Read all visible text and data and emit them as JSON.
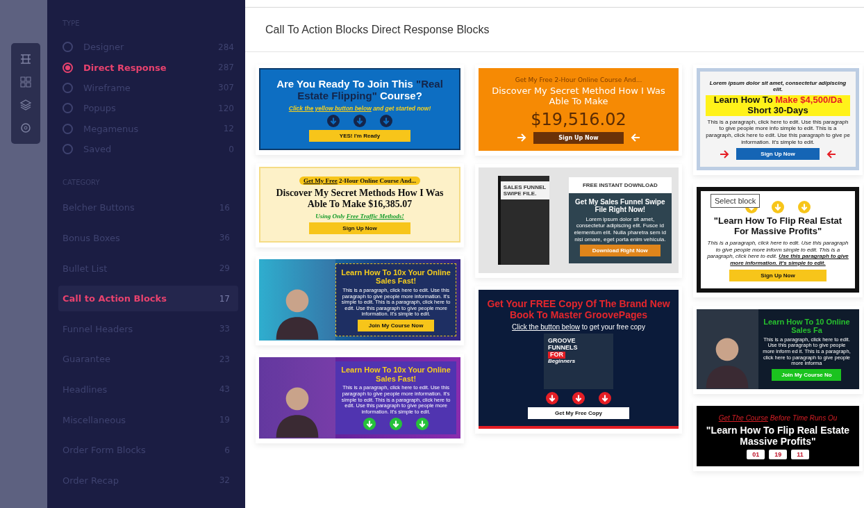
{
  "type_filter": {
    "heading": "TYPE",
    "items": [
      {
        "label": "Designer",
        "count": "284",
        "selected": false
      },
      {
        "label": "Direct Response",
        "count": "287",
        "selected": true
      },
      {
        "label": "Wireframe",
        "count": "307",
        "selected": false
      },
      {
        "label": "Popups",
        "count": "120",
        "selected": false
      },
      {
        "label": "Megamenus",
        "count": "12",
        "selected": false
      },
      {
        "label": "Saved",
        "count": "0",
        "selected": false
      }
    ]
  },
  "category_filter": {
    "heading": "CATEGORY",
    "items": [
      {
        "label": "Belcher Buttons",
        "count": "16",
        "selected": false
      },
      {
        "label": "Bonus Boxes",
        "count": "36",
        "selected": false
      },
      {
        "label": "Bullet List",
        "count": "29",
        "selected": false
      },
      {
        "label": "Call to Action Blocks",
        "count": "17",
        "selected": true
      },
      {
        "label": "Funnel Headers",
        "count": "33",
        "selected": false
      },
      {
        "label": "Guarantee",
        "count": "23",
        "selected": false
      },
      {
        "label": "Headlines",
        "count": "43",
        "selected": false
      },
      {
        "label": "Miscellaneous",
        "count": "19",
        "selected": false
      },
      {
        "label": "Order Form Blocks",
        "count": "6",
        "selected": false
      },
      {
        "label": "Order Recap",
        "count": "32",
        "selected": false
      }
    ]
  },
  "page_title": "Call To Action Blocks Direct Response Blocks",
  "columns": [
    [
      {
        "kind": "blue",
        "parts": [
          {
            "kind": "headline",
            "segments": [
              {
                "text": "Are You Ready To Join This ",
                "accent": false
              },
              {
                "text": "\"Real Estate Flipping\"",
                "accent": true
              },
              {
                "text": " Course?",
                "accent": false
              }
            ]
          },
          {
            "kind": "sub",
            "segments": [
              {
                "text": "Click the yellow button below",
                "accent": true
              },
              {
                "text": " and get started now!",
                "accent": false
              }
            ]
          },
          {
            "kind": "arrows"
          },
          {
            "kind": "button",
            "text": "YES! I'm Ready"
          }
        ]
      },
      {
        "kind": "cream",
        "parts": [
          {
            "kind": "kicker",
            "segments": [
              {
                "text": "Get My Free",
                "accent": true
              },
              {
                "text": " 2-Hour Online Course And...",
                "accent": false
              }
            ]
          },
          {
            "kind": "headline",
            "text": "Discover My Secret Methods How I Was Able To Make $16,385.07"
          },
          {
            "kind": "sub",
            "segments": [
              {
                "text": "Using Only ",
                "accent": false
              },
              {
                "text": "Free Traffic Methods!",
                "accent": true
              }
            ]
          },
          {
            "kind": "button",
            "text": "Sign Up Now"
          }
        ]
      },
      {
        "kind": "teal",
        "parts": [
          {
            "kind": "headline",
            "text": "Learn How To 10x Your Online Sales Fast!"
          },
          {
            "kind": "paragraph",
            "text": "This is a paragraph, click here to edit. Use this paragraph to give people more information. It's simple to edit. This is a paragraph, click here to edit. Use this paragraph to give people more information. It's simple to edit."
          },
          {
            "kind": "button",
            "text": "Join My Course Now"
          }
        ]
      },
      {
        "kind": "purple",
        "parts": [
          {
            "kind": "headline",
            "text": "Learn How To 10x Your Online Sales Fast!"
          },
          {
            "kind": "paragraph",
            "text": "This is a paragraph, click here to edit. Use this paragraph to give people more information. It's simple to edit. This is a paragraph, click here to edit. Use this paragraph to give people more information. It's simple to edit."
          },
          {
            "kind": "arrows"
          }
        ]
      }
    ],
    [
      {
        "kind": "orange",
        "parts": [
          {
            "kind": "kicker",
            "text": "Get My Free 2-Hour Online Course And..."
          },
          {
            "kind": "headline",
            "text": "Discover My Secret Method How I Was Able To Make"
          },
          {
            "kind": "price",
            "text": "$19,516.02"
          },
          {
            "kind": "button",
            "text": "Sign Up Now",
            "side_arrows": true
          }
        ]
      },
      {
        "kind": "grey",
        "book_title": "SALES FUNNEL SWIPE FILE.",
        "parts": [
          {
            "kind": "header",
            "text": "FREE INSTANT DOWNLOAD"
          },
          {
            "kind": "headline",
            "text": "Get My Sales Funnel Swipe File Right Now!"
          },
          {
            "kind": "paragraph",
            "text": "Lorem ipsum dolor sit amet, consectetur adipiscing elit. Fusce id elementum elit. Nulla pharetra sem id nisi ornare, eget porta enim vehicula."
          },
          {
            "kind": "button",
            "text": "Download Right Now"
          }
        ]
      },
      {
        "kind": "navy",
        "parts": [
          {
            "kind": "headline",
            "text": "Get Your FREE Copy Of The Brand New Book To Master GroovePages"
          },
          {
            "kind": "sub",
            "segments": [
              {
                "text": "Click the button below",
                "accent": true
              },
              {
                "text": " to get your free copy",
                "accent": false
              }
            ]
          },
          {
            "kind": "cover",
            "lines": [
              "GROOVE",
              "FUNNELS",
              "FOR",
              "Beginners"
            ]
          },
          {
            "kind": "arrows"
          },
          {
            "kind": "button",
            "text": "Get My Free Copy"
          }
        ]
      }
    ],
    [
      {
        "kind": "light",
        "parts": [
          {
            "kind": "kicker",
            "text": "Lorem ipsum dolor sit amet, consectetur adipiscing elit."
          },
          {
            "kind": "headline",
            "segments": [
              {
                "text": "Learn How To ",
                "accent": false
              },
              {
                "text": "Make $4,500/Da",
                "accent": true
              },
              {
                "text": " Short 30-Days",
                "accent": false
              }
            ]
          },
          {
            "kind": "paragraph",
            "text": "This is a paragraph, click here to edit. Use this paragraph to give people more info simple to edit. This is a paragraph, click here to edit. Use this paragraph to give pe information. It's simple to edit."
          },
          {
            "kind": "button",
            "text": "Sign Up Now",
            "side_arrows": true
          }
        ]
      },
      {
        "kind": "framed",
        "tooltip": "Select block",
        "parts": [
          {
            "kind": "arrows"
          },
          {
            "kind": "headline",
            "text": "\"Learn How To Flip Real Estat For Massive Profits\""
          },
          {
            "kind": "paragraph",
            "segments": [
              {
                "text": "This is a paragraph, click here to edit. Use this paragraph to give people more inform simple to edit. This is a paragraph, click here to edit. ",
                "accent": false
              },
              {
                "text": "Use this paragraph to give more information. It's simple to edit.",
                "accent": true
              }
            ]
          },
          {
            "kind": "button",
            "text": "Sign Up Now"
          }
        ]
      },
      {
        "kind": "dark",
        "parts": [
          {
            "kind": "headline",
            "text": "Learn How To 10 Online Sales Fa"
          },
          {
            "kind": "paragraph",
            "text": "This is a paragraph, click here to edit. Use this paragraph to give people more inform ed it. This is a paragraph, click here to paragraph to give people more informa"
          },
          {
            "kind": "button",
            "text": "Join My Course No"
          }
        ]
      },
      {
        "kind": "black",
        "parts": [
          {
            "kind": "kicker",
            "segments": [
              {
                "text": "Get The Course",
                "accent": true
              },
              {
                "text": " Before Time Runs Ou",
                "accent": false
              }
            ]
          },
          {
            "kind": "headline",
            "text": "\"Learn How To Flip Real Estate Massive Profits\""
          },
          {
            "kind": "countdown",
            "values": [
              "01",
              "19",
              "11"
            ]
          }
        ]
      }
    ]
  ]
}
